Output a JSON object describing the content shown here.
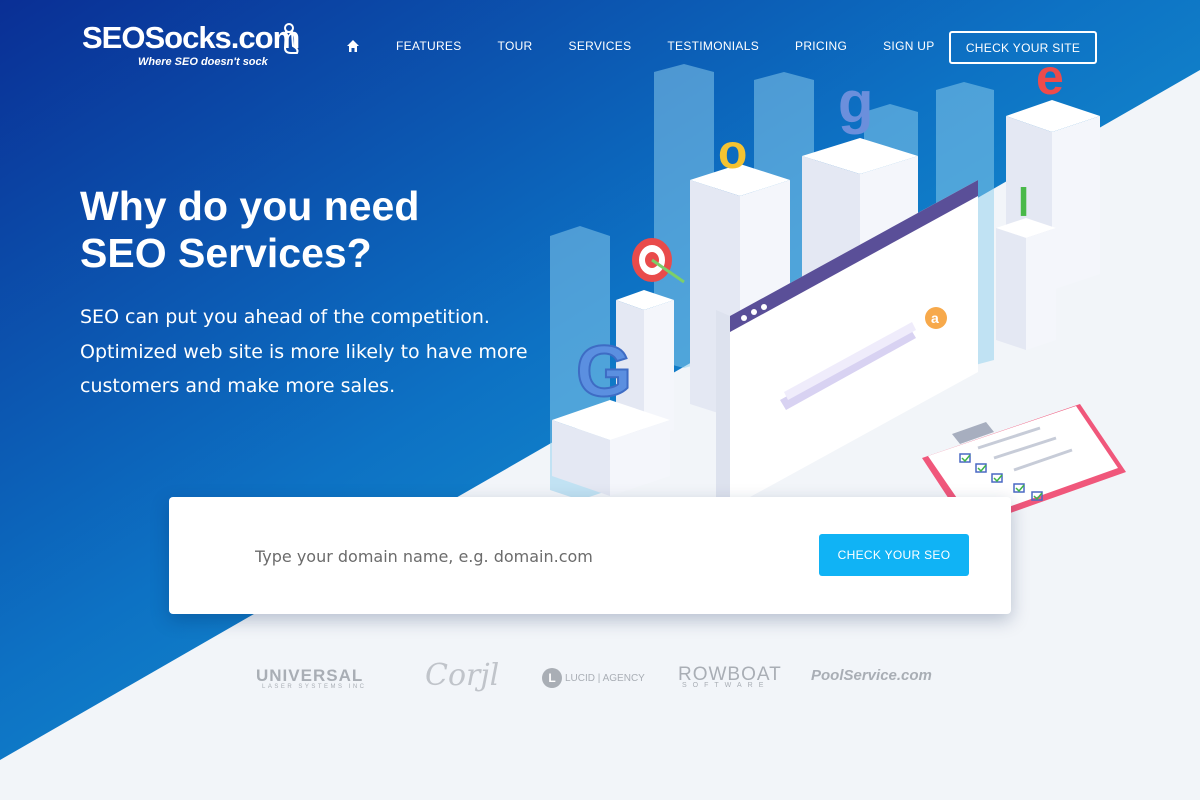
{
  "brand": {
    "name": "SEOSocks.com",
    "tagline": "Where SEO doesn't sock"
  },
  "nav": {
    "home_icon": "home-icon",
    "items": [
      "FEATURES",
      "TOUR",
      "SERVICES",
      "TESTIMONIALS",
      "PRICING",
      "SIGN UP"
    ],
    "cta": "CHECK YOUR SITE"
  },
  "hero": {
    "title_line1": "Why do you need",
    "title_line2": "SEO Services?",
    "subtitle_line1": "SEO can put you ahead of the competition.",
    "subtitle_line2": "Optimized web site is more likely to have more",
    "subtitle_line3": "customers and make more sales."
  },
  "search": {
    "placeholder": "Type your domain name, e.g. domain.com",
    "value": "",
    "button": "CHECK YOUR SEO"
  },
  "illustration": {
    "letters": [
      "G",
      "o",
      "o",
      "g",
      "l",
      "e"
    ],
    "search_key": "a"
  },
  "partners": [
    {
      "name": "UNIVERSAL",
      "sub": "LASER SYSTEMS INC"
    },
    {
      "name": "Corjl",
      "sub": ""
    },
    {
      "name": "L",
      "sub": "LUCID | AGENCY"
    },
    {
      "name": "ROWBOAT",
      "sub": "SOFTWARE"
    },
    {
      "name": "PoolService.com",
      "sub": ""
    }
  ],
  "colors": {
    "hero_dark": "#0a3a9e",
    "hero_light": "#17a8d6",
    "accent_button": "#10b3f5",
    "page_bg": "#f2f5f9"
  }
}
